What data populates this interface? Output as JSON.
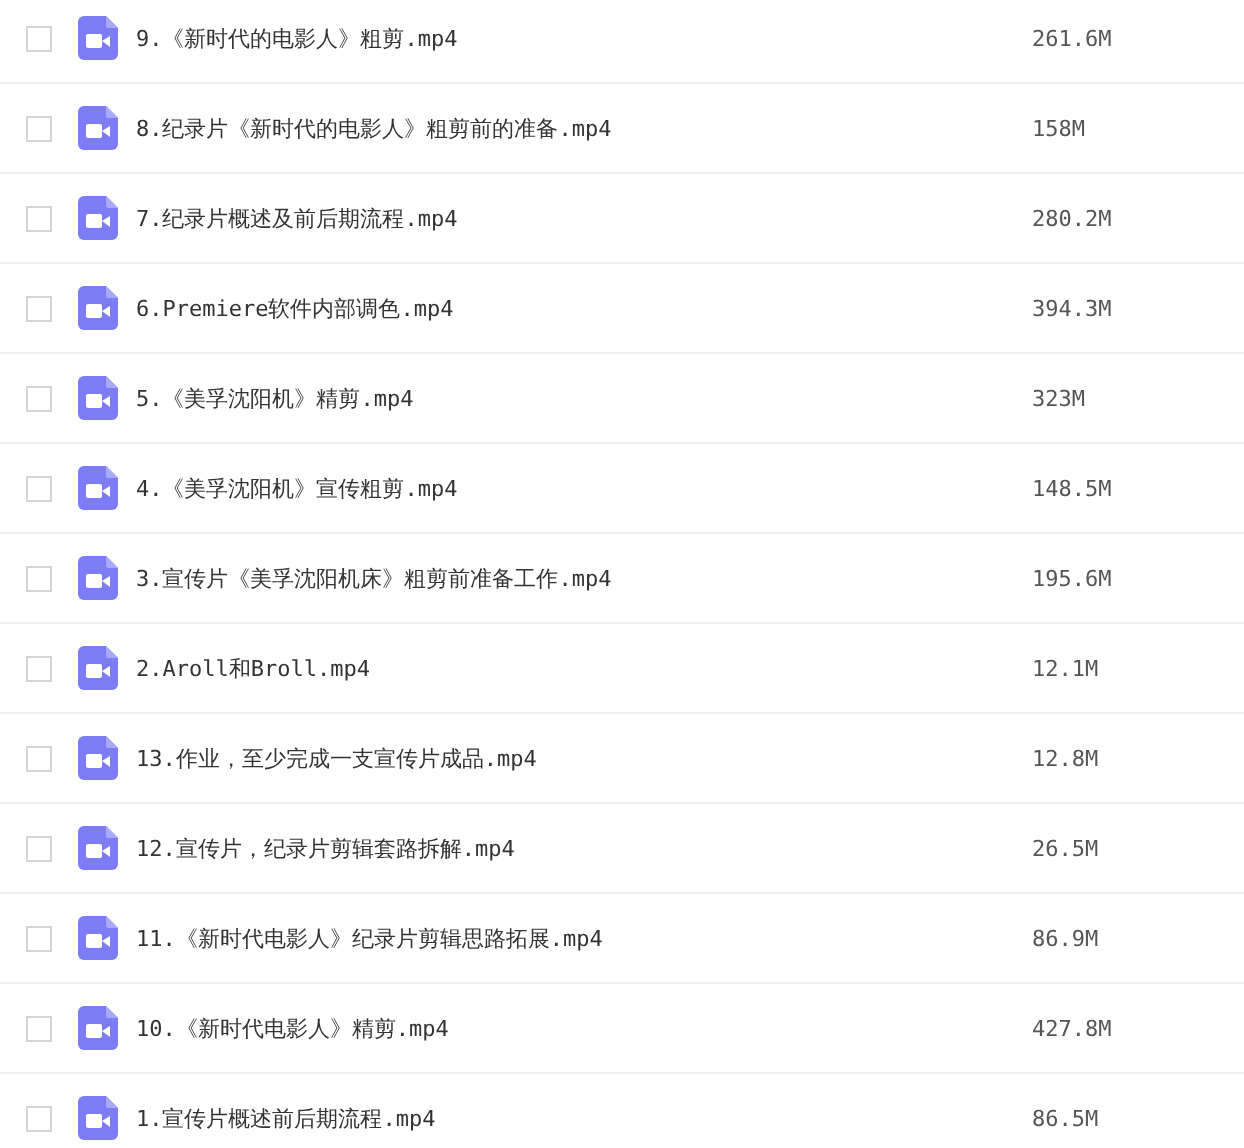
{
  "files": [
    {
      "name": "9.《新时代的电影人》粗剪.mp4",
      "size": "261.6M",
      "checked": false
    },
    {
      "name": "8.纪录片《新时代的电影人》粗剪前的准备.mp4",
      "size": "158M",
      "checked": false
    },
    {
      "name": "7.纪录片概述及前后期流程.mp4",
      "size": "280.2M",
      "checked": false
    },
    {
      "name": "6.Premiere软件内部调色.mp4",
      "size": "394.3M",
      "checked": false
    },
    {
      "name": "5.《美孚沈阳机》精剪.mp4",
      "size": "323M",
      "checked": false
    },
    {
      "name": "4.《美孚沈阳机》宣传粗剪.mp4",
      "size": "148.5M",
      "checked": false
    },
    {
      "name": "3.宣传片《美孚沈阳机床》粗剪前准备工作.mp4",
      "size": "195.6M",
      "checked": false
    },
    {
      "name": "2.Aroll和Broll.mp4",
      "size": "12.1M",
      "checked": false
    },
    {
      "name": "13.作业，至少完成一支宣传片成品.mp4",
      "size": "12.8M",
      "checked": false
    },
    {
      "name": "12.宣传片，纪录片剪辑套路拆解.mp4",
      "size": "26.5M",
      "checked": false
    },
    {
      "name": "11.《新时代电影人》纪录片剪辑思路拓展.mp4",
      "size": "86.9M",
      "checked": false
    },
    {
      "name": "10.《新时代电影人》精剪.mp4",
      "size": "427.8M",
      "checked": false
    },
    {
      "name": "1.宣传片概述前后期流程.mp4",
      "size": "86.5M",
      "checked": false
    }
  ]
}
